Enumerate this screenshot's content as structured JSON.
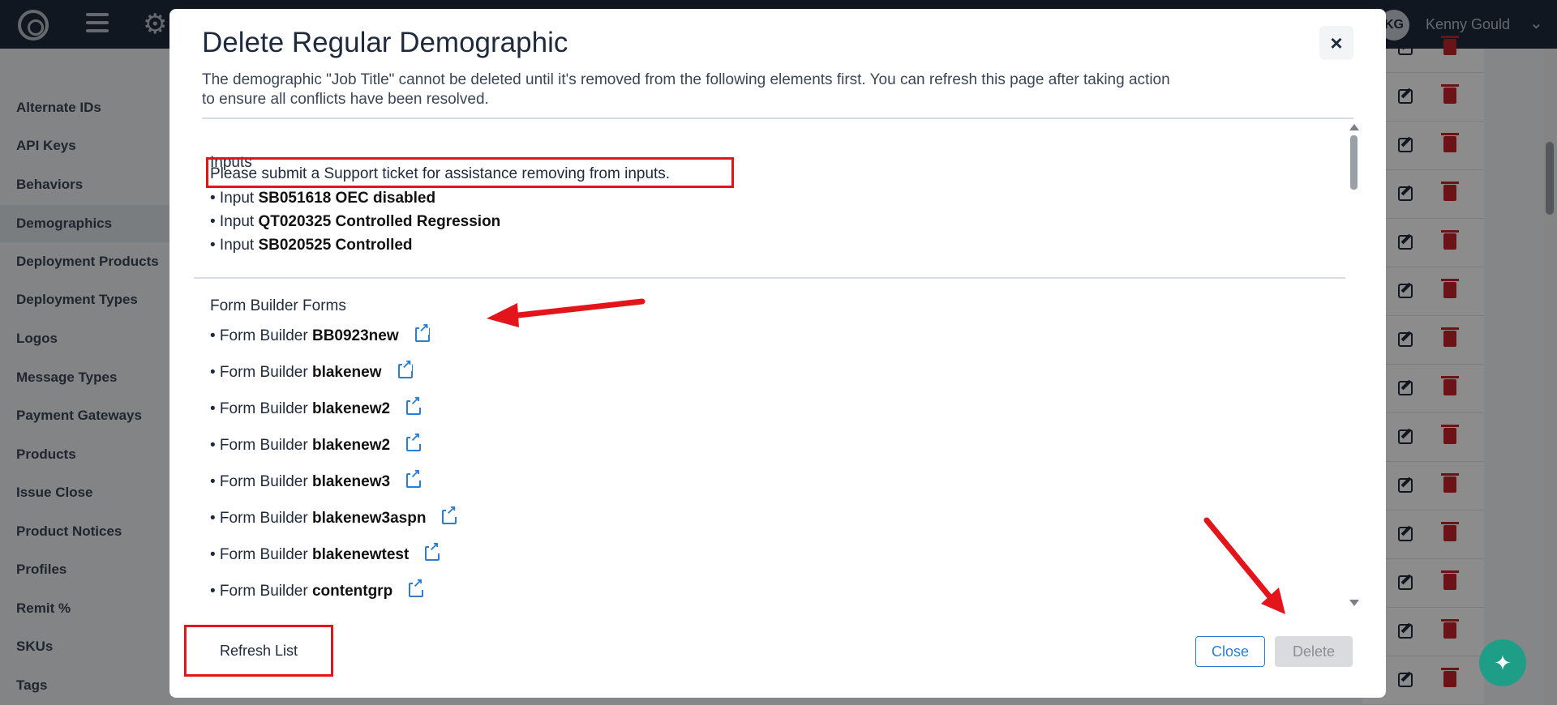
{
  "topbar": {
    "avatar_initials": "KG",
    "user_name": "Kenny Gould"
  },
  "sidebar": {
    "items": [
      {
        "label": "Alternate IDs"
      },
      {
        "label": "API Keys"
      },
      {
        "label": "Behaviors"
      },
      {
        "label": "Demographics",
        "active": true
      },
      {
        "label": "Deployment Products"
      },
      {
        "label": "Deployment Types"
      },
      {
        "label": "Logos"
      },
      {
        "label": "Message Types"
      },
      {
        "label": "Payment Gateways"
      },
      {
        "label": "Products"
      },
      {
        "label": "Issue Close"
      },
      {
        "label": "Product Notices"
      },
      {
        "label": "Profiles"
      },
      {
        "label": "Remit %"
      },
      {
        "label": "SKUs"
      },
      {
        "label": "Tags"
      }
    ]
  },
  "modal": {
    "title": "Delete Regular Demographic",
    "close_icon": "×",
    "description": "The demographic \"Job Title\" cannot be deleted until it's removed from the following elements first. You can refresh this page after taking action to ensure all conflicts have been resolved.",
    "inputs_section": {
      "title": "Inputs",
      "note": "Please submit a Support ticket for assistance removing from inputs.",
      "items": [
        {
          "prefix": "• Input ",
          "name": "SB051618 OEC disabled"
        },
        {
          "prefix": "• Input ",
          "name": "QT020325 Controlled Regression"
        },
        {
          "prefix": "• Input ",
          "name": "SB020525 Controlled"
        }
      ]
    },
    "forms_section": {
      "title": "Form Builder Forms",
      "items": [
        {
          "prefix": "• Form Builder ",
          "name": "BB0923new"
        },
        {
          "prefix": "• Form Builder ",
          "name": "blakenew"
        },
        {
          "prefix": "• Form Builder ",
          "name": "blakenew2"
        },
        {
          "prefix": "• Form Builder ",
          "name": "blakenew2"
        },
        {
          "prefix": "• Form Builder ",
          "name": "blakenew3"
        },
        {
          "prefix": "• Form Builder ",
          "name": "blakenew3aspn"
        },
        {
          "prefix": "• Form Builder ",
          "name": "blakenewtest"
        },
        {
          "prefix": "• Form Builder ",
          "name": "contentgrp"
        }
      ]
    },
    "buttons": {
      "refresh": "Refresh List",
      "close": "Close",
      "delete": "Delete"
    }
  },
  "colors": {
    "topbar": "#1f2a3c",
    "link_blue": "#2a7fd4",
    "annotation_red": "#e4141b",
    "delete_red": "#c4232a",
    "help_green": "#1e9e86"
  },
  "icons": {
    "help": "sparkle-icon",
    "external": "external-link-icon"
  }
}
